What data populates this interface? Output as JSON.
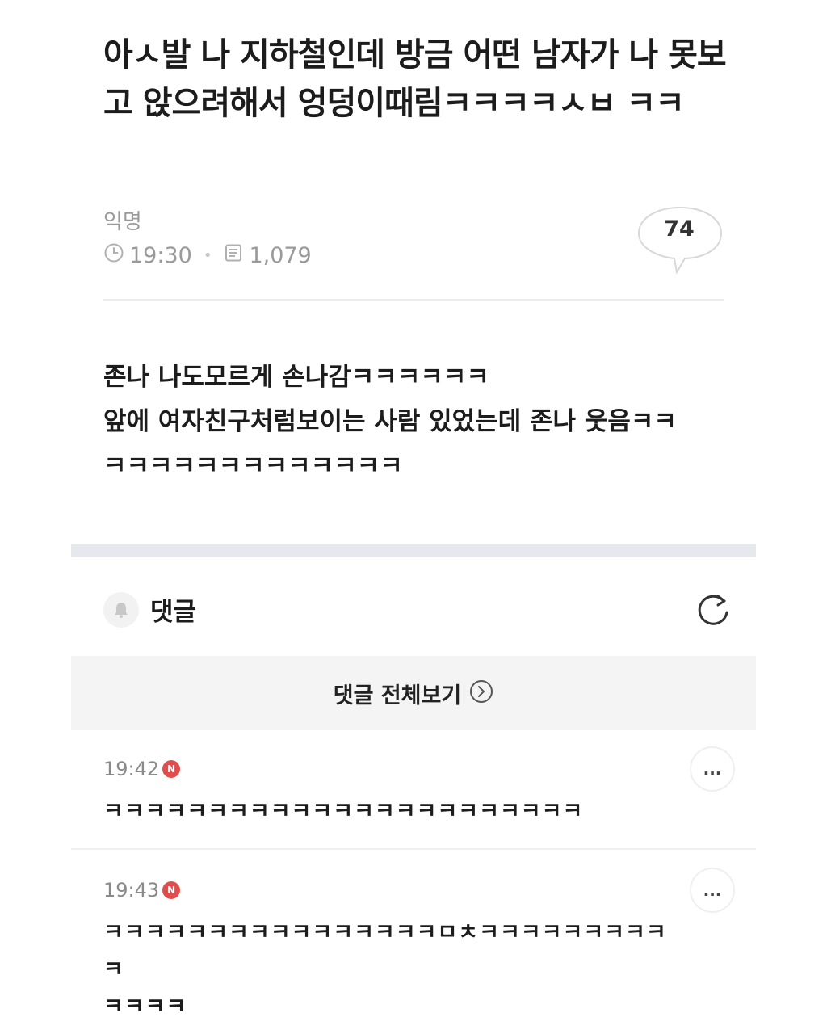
{
  "post": {
    "title": "아ㅅ발 나 지하철인데 방금 어떤 남자가 나 못보고 앉으려해서 엉덩이때림ㅋㅋㅋㅋㅅㅂ ㅋㅋ",
    "author": "익명",
    "time": "19:30",
    "views": "1,079",
    "comment_count": "74",
    "body": "존나 나도모르게 손나감ㅋㅋㅋㅋㅋㅋ\n앞에 여자친구처럼보이는 사람 있었는데 존나 웃음ㅋㅋ\nㅋㅋㅋㅋㅋㅋㅋㅋㅋㅋㅋㅋㅋ"
  },
  "comments_section": {
    "title": "댓글",
    "view_all_label": "댓글 전체보기",
    "icons": {
      "bell": "bell-icon",
      "refresh": "refresh-icon",
      "view_all": "chevron-right-circle-icon",
      "more": "more-icon"
    },
    "items": [
      {
        "time": "19:42",
        "badge": "N",
        "text": "ㅋㅋㅋㅋㅋㅋㅋㅋㅋㅋㅋㅋㅋㅋㅋㅋㅋㅋㅋㅋㅋㅋㅋ",
        "more_label": "..."
      },
      {
        "time": "19:43",
        "badge": "N",
        "text": "ㅋㅋㅋㅋㅋㅋㅋㅋㅋㅋㅋㅋㅋㅋㅋㅋㅁㅊㅋㅋㅋㅋㅋㅋㅋㅋㅋㅋ\nㅋㅋㅋㅋ",
        "more_label": "..."
      }
    ]
  },
  "colors": {
    "badge": "#e04d4d",
    "divider": "#ececec",
    "band": "#e6e8ee",
    "view_all_bg": "#f4f4f5"
  }
}
